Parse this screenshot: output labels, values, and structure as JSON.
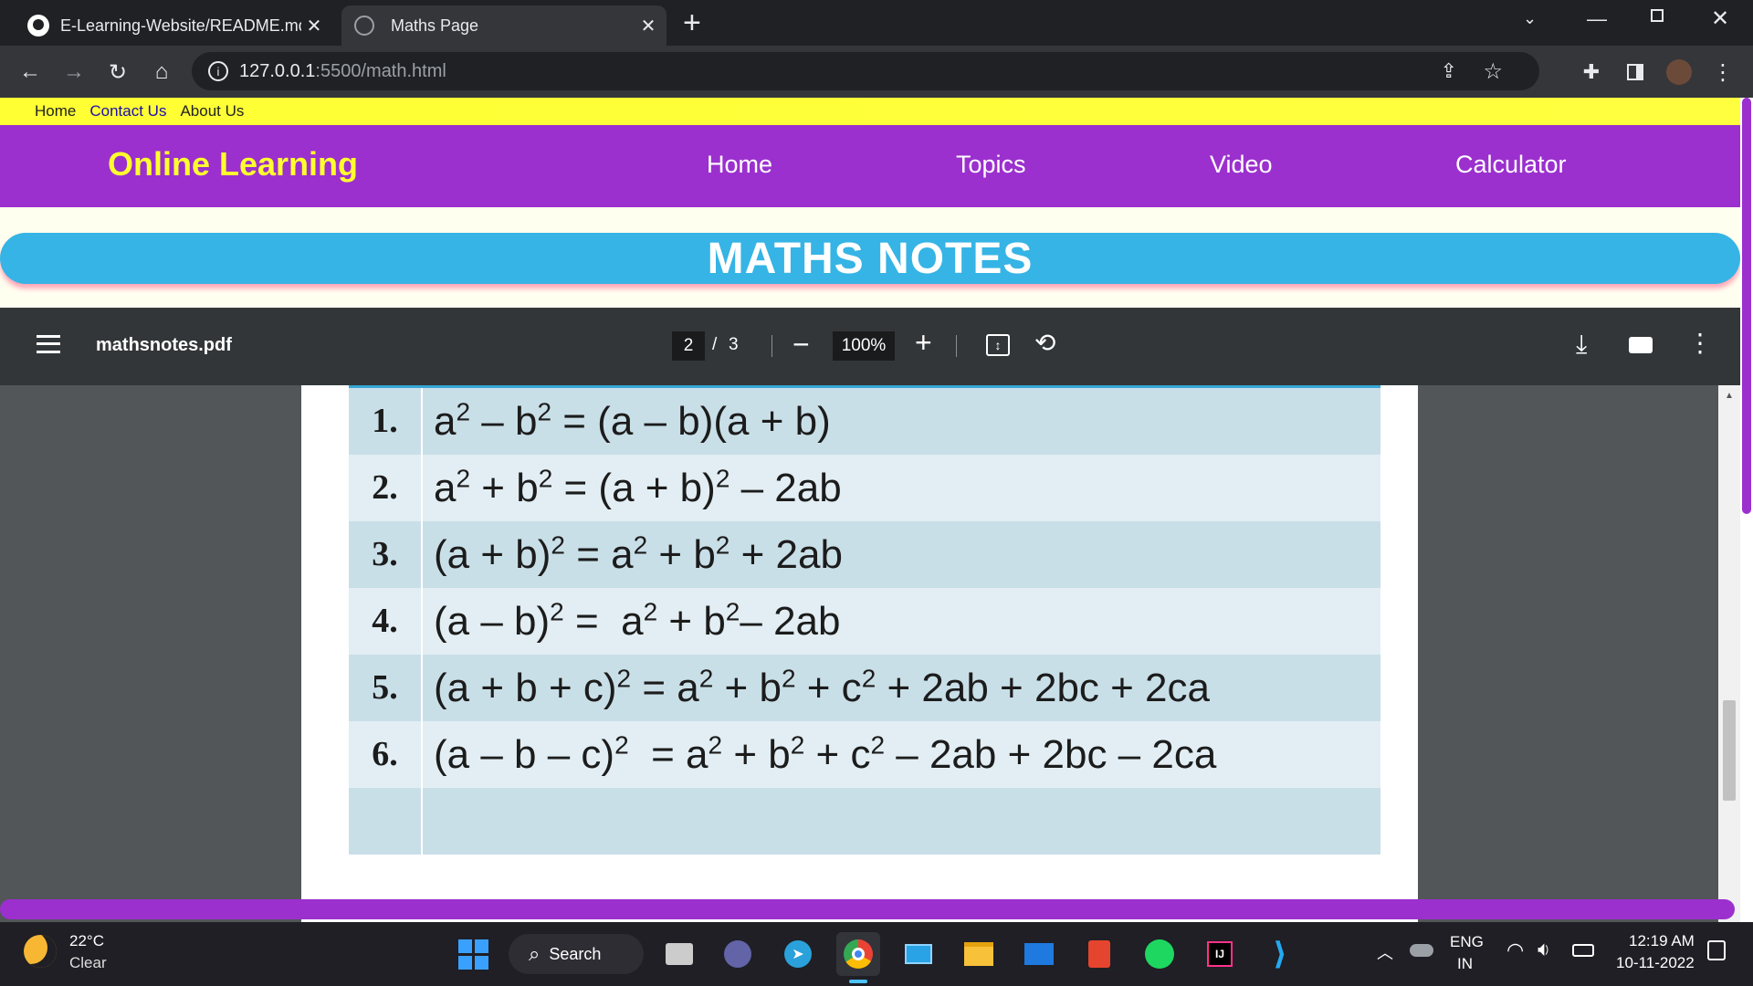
{
  "browser": {
    "tabs": [
      {
        "title": "E-Learning-Website/README.md",
        "active": false
      },
      {
        "title": "Maths Page",
        "active": true
      }
    ],
    "new_tab": "+",
    "url_host": "127.0.0.1",
    "url_rest": ":5500/math.html"
  },
  "page": {
    "top_links": [
      "Home",
      "Contact Us",
      "About Us"
    ],
    "brand": "Online Learning",
    "nav": [
      "Home",
      "Topics",
      "Video",
      "Calculator"
    ],
    "banner": "MATHS NOTES"
  },
  "pdf": {
    "filename": "mathsnotes.pdf",
    "page_current": "2",
    "page_sep": "/",
    "page_total": "3",
    "zoom": "100%",
    "formulas": [
      {
        "n": "1.",
        "html": "a<sup>2</sup> – b<sup>2</sup> = (a – b)(a + b)"
      },
      {
        "n": "2.",
        "html": "a<sup>2</sup> + b<sup>2</sup> = (a + b)<sup>2</sup> – 2ab"
      },
      {
        "n": "3.",
        "html": "(a + b)<sup>2</sup> = a<sup>2</sup> + b<sup>2</sup> + 2ab"
      },
      {
        "n": "4.",
        "html": "(a – b)<sup>2</sup> = &nbsp;a<sup>2</sup> + b<sup>2</sup>– 2ab"
      },
      {
        "n": "5.",
        "html": "(a + b + c)<sup>2</sup> = a<sup>2</sup> + b<sup>2</sup> + c<sup>2</sup> + 2ab + 2bc + 2ca"
      },
      {
        "n": "6.",
        "html": "(a – b – c)<sup>2</sup> &nbsp;= a<sup>2</sup> + b<sup>2</sup> + c<sup>2</sup> – 2ab + 2bc – 2ca"
      }
    ]
  },
  "taskbar": {
    "weather_temp": "22°C",
    "weather_desc": "Clear",
    "search": "Search",
    "lang": "ENG",
    "region": "IN",
    "time": "12:19 AM",
    "date": "10-11-2022"
  }
}
